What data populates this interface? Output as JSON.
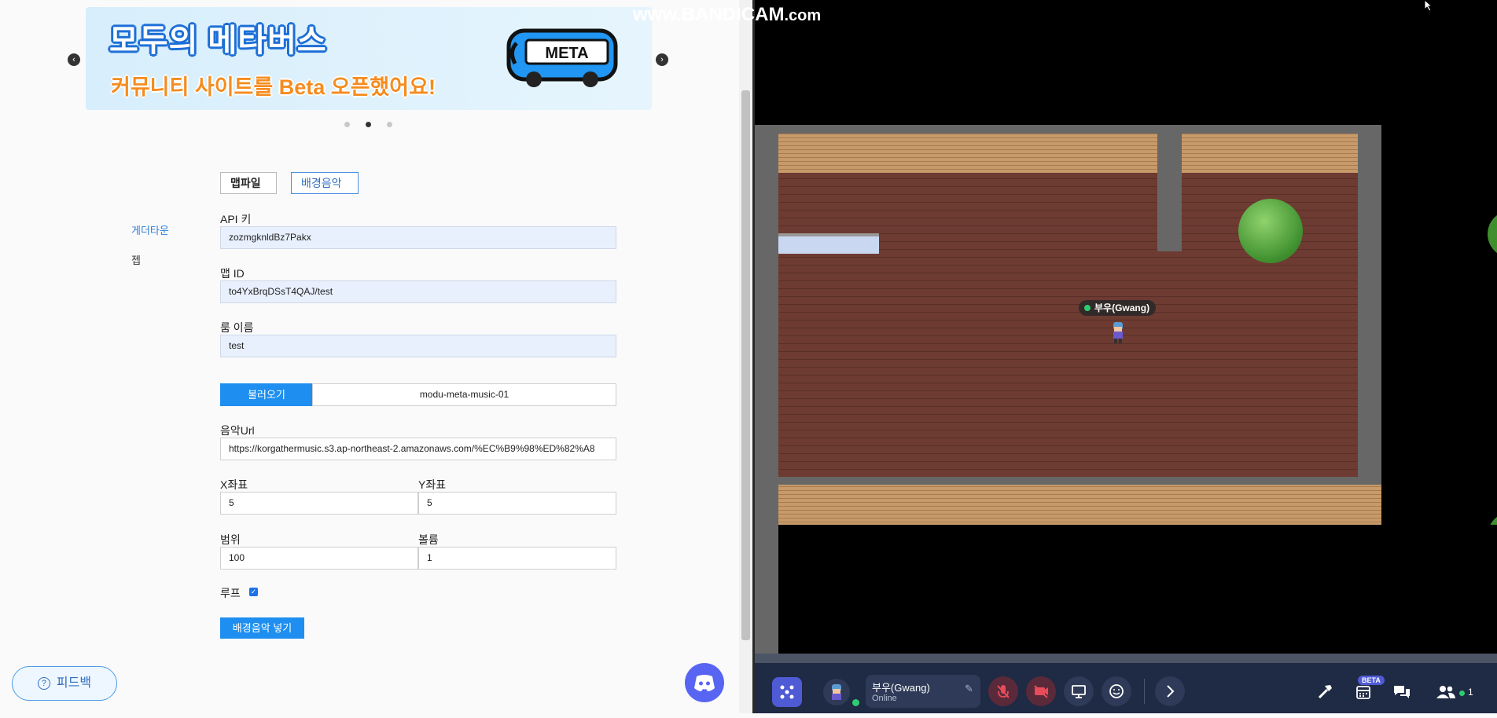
{
  "banner": {
    "title": "모두의 메타버스",
    "subtitle": "커뮤니티 사이트를 Beta 오픈했어요!",
    "bus_label": "META",
    "prev_label": "‹",
    "next_label": "›"
  },
  "tabs": [
    {
      "label": "맵파일"
    },
    {
      "label": "배경음악"
    }
  ],
  "sidebar": {
    "items": [
      {
        "label": "게더타운"
      },
      {
        "label": "젭"
      }
    ]
  },
  "form": {
    "api_key_label": "API 키",
    "api_key_value": "zozmgknldBz7Pakx",
    "map_id_label": "맵 ID",
    "map_id_value": "to4YxBrqDSsT4QAJ/test",
    "room_name_label": "룸 이름",
    "room_name_value": "test",
    "load_button": "불러오기",
    "load_value": "modu-meta-music-01",
    "music_url_label": "음악Url",
    "music_url_value": "https://korgathermusic.s3.ap-northeast-2.amazonaws.com/%EC%B9%98%ED%82%A8",
    "x_label": "X좌표",
    "x_value": "5",
    "y_label": "Y좌표",
    "y_value": "5",
    "range_label": "범위",
    "range_value": "100",
    "volume_label": "볼륨",
    "volume_value": "1",
    "loop_label": "루프",
    "loop_checked": true,
    "submit_button": "배경음악 넣기"
  },
  "feedback": {
    "label": "피드백"
  },
  "watermark": {
    "main": "www.BANDICAM",
    "suffix": ".com"
  },
  "game": {
    "player_name": "부우(Gwang)",
    "hud": {
      "user_name": "부우(Gwang)",
      "user_status": "Online",
      "beta_badge": "BETA",
      "participant_count": "1"
    }
  },
  "colors": {
    "accent": "#1e8ff0",
    "hud_bg": "#1f2a44",
    "floor": "#6d3b32",
    "online": "#2ecc71"
  }
}
